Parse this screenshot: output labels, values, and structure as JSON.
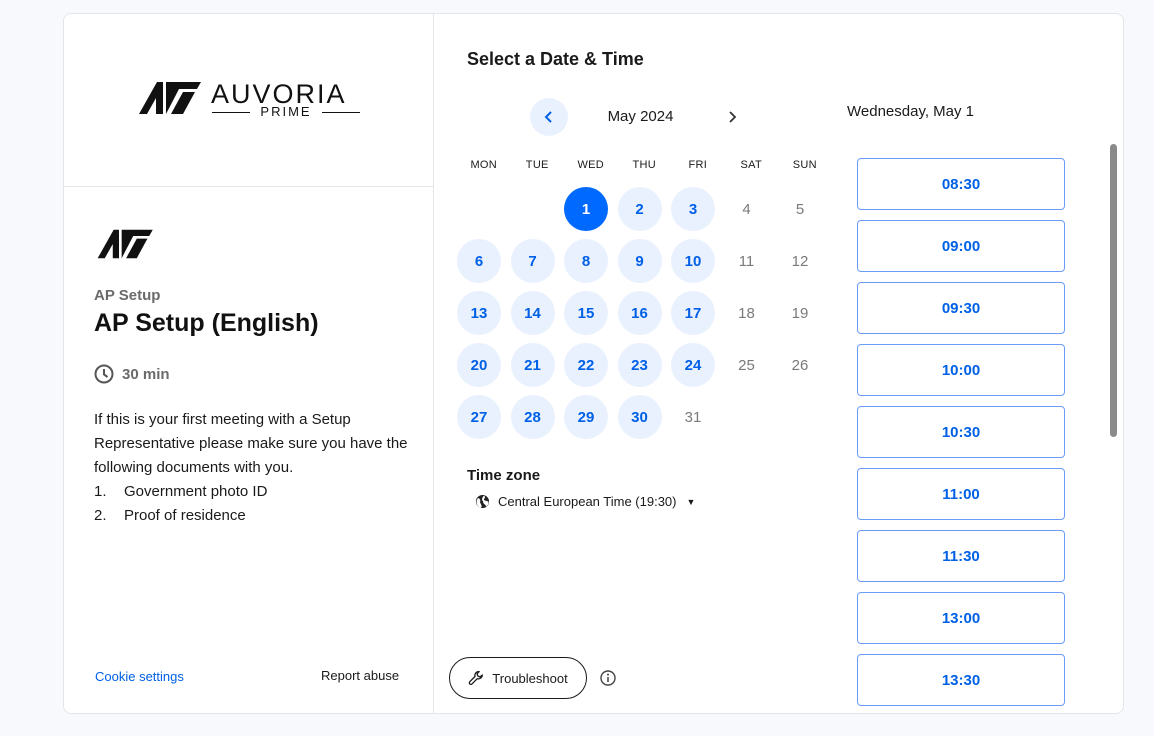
{
  "brand": {
    "name": "AUVORIA",
    "sub": "PRIME"
  },
  "event": {
    "owner": "AP Setup",
    "title": "AP Setup (English)",
    "duration": "30 min",
    "description": "If this is your first meeting with a Setup Representative please make sure you have the following documents with you.",
    "documents": [
      {
        "num": "1.",
        "text": "Government photo ID"
      },
      {
        "num": "2.",
        "text": "Proof of residence"
      }
    ]
  },
  "footer": {
    "cookie_label": "Cookie settings",
    "report_label": "Report abuse"
  },
  "calendar": {
    "heading": "Select a Date & Time",
    "month_label": "May 2024",
    "weekdays": [
      "MON",
      "TUE",
      "WED",
      "THU",
      "FRI",
      "SAT",
      "SUN"
    ],
    "days": [
      {
        "d": "1",
        "state": "selected"
      },
      {
        "d": "2",
        "state": "available"
      },
      {
        "d": "3",
        "state": "available"
      },
      {
        "d": "4",
        "state": "unavailable"
      },
      {
        "d": "5",
        "state": "unavailable"
      },
      {
        "d": "6",
        "state": "available"
      },
      {
        "d": "7",
        "state": "available"
      },
      {
        "d": "8",
        "state": "available"
      },
      {
        "d": "9",
        "state": "available"
      },
      {
        "d": "10",
        "state": "available"
      },
      {
        "d": "11",
        "state": "unavailable"
      },
      {
        "d": "12",
        "state": "unavailable"
      },
      {
        "d": "13",
        "state": "available"
      },
      {
        "d": "14",
        "state": "available"
      },
      {
        "d": "15",
        "state": "available"
      },
      {
        "d": "16",
        "state": "available"
      },
      {
        "d": "17",
        "state": "available"
      },
      {
        "d": "18",
        "state": "unavailable"
      },
      {
        "d": "19",
        "state": "unavailable"
      },
      {
        "d": "20",
        "state": "available"
      },
      {
        "d": "21",
        "state": "available"
      },
      {
        "d": "22",
        "state": "available"
      },
      {
        "d": "23",
        "state": "available"
      },
      {
        "d": "24",
        "state": "available"
      },
      {
        "d": "25",
        "state": "unavailable"
      },
      {
        "d": "26",
        "state": "unavailable"
      },
      {
        "d": "27",
        "state": "available"
      },
      {
        "d": "28",
        "state": "available"
      },
      {
        "d": "29",
        "state": "available"
      },
      {
        "d": "30",
        "state": "available"
      },
      {
        "d": "31",
        "state": "unavailable"
      }
    ],
    "first_weekday_index": 2
  },
  "timezone": {
    "label": "Time zone",
    "value": "Central European Time (19:30)"
  },
  "troubleshoot_label": "Troubleshoot",
  "selected_date_label": "Wednesday, May 1",
  "time_slots": [
    "08:30",
    "09:00",
    "09:30",
    "10:00",
    "10:30",
    "11:00",
    "11:30",
    "13:00",
    "13:30"
  ],
  "colors": {
    "accent": "#0069ff",
    "link": "#0060e6",
    "available_bg": "#e9f1fe",
    "border": "#e3e5ea"
  },
  "icons": [
    "auvoria-logo",
    "clock-icon",
    "chevron-left-icon",
    "chevron-right-icon",
    "globe-icon",
    "wrench-icon",
    "info-icon"
  ]
}
